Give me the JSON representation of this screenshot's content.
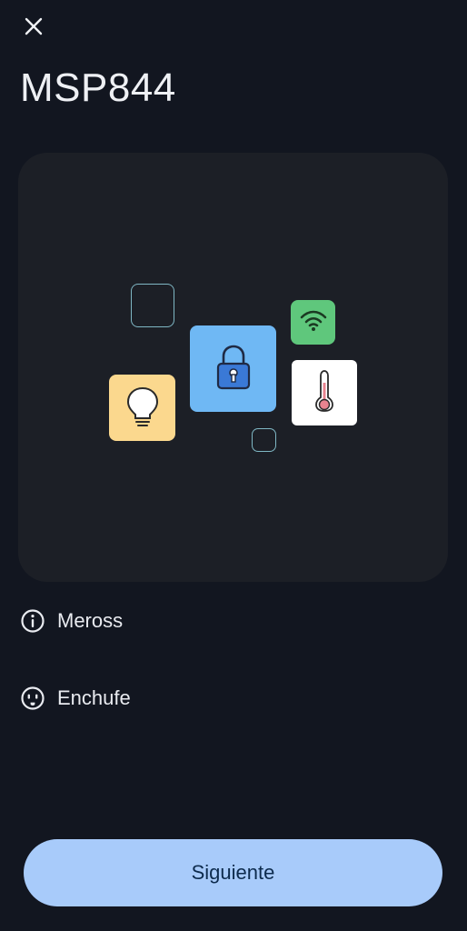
{
  "header": {
    "title": "MSP844",
    "close_icon": "close-icon"
  },
  "illustration": {
    "icons": [
      "lightbulb-icon",
      "lock-icon",
      "wifi-icon",
      "thermometer-icon"
    ],
    "colors": {
      "card": "#1c1f26",
      "bulb_tile": "#fbd88e",
      "lock_tile": "#6fb8f4",
      "wifi_tile": "#5fc77c",
      "thermometer_tile": "#ffffff",
      "outline": "#7fb7c4"
    }
  },
  "details": [
    {
      "icon": "info-icon",
      "label": "Meross"
    },
    {
      "icon": "outlet-icon",
      "label": "Enchufe"
    }
  ],
  "footer": {
    "next_label": "Siguiente",
    "button_color": "#a8cbfa"
  }
}
